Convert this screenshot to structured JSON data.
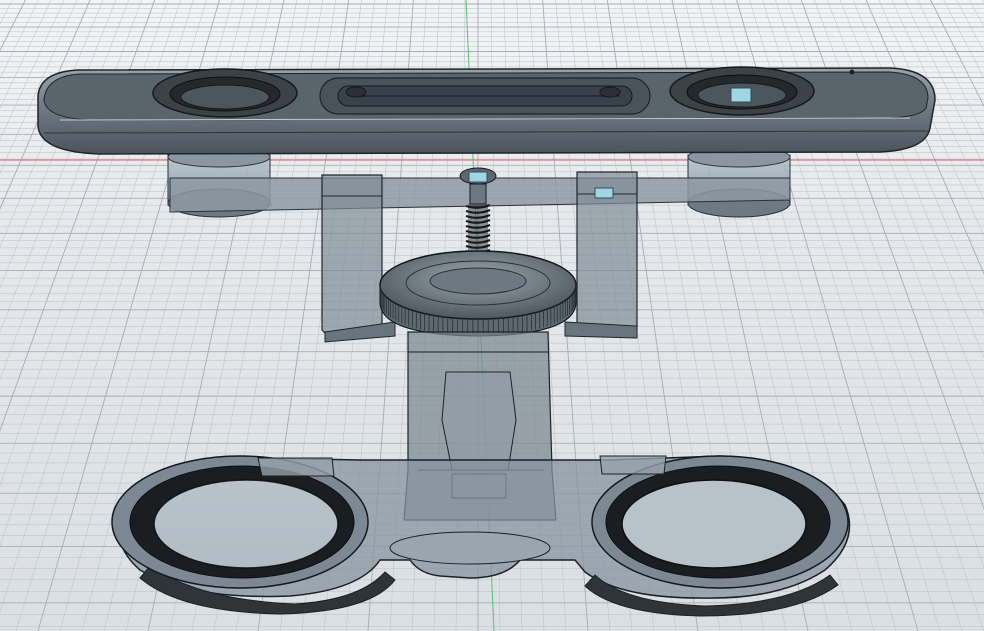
{
  "viewport": {
    "name": "3d-cad-viewport",
    "background_top": "#f2f4f6",
    "background_bottom": "#d9dee2",
    "grid_color": "#b9c0c6",
    "grid_major_color": "#a6aeb5",
    "axis_x_color": "#e35d5d",
    "axis_y_color": "#52c86a"
  },
  "model": {
    "body_color": "#7f8b94",
    "body_dark": "#3e464c",
    "edge_color": "#1f2428",
    "glass_color": "#9fb2bf",
    "gasket_color": "#1b1e21",
    "marker_color": "#9fd6e4",
    "parts": [
      {
        "id": "top-bar",
        "label": ""
      },
      {
        "id": "left-speaker",
        "label": ""
      },
      {
        "id": "right-speaker",
        "label": ""
      },
      {
        "id": "clamp-knob",
        "label": ""
      },
      {
        "id": "threaded-rod",
        "label": ""
      },
      {
        "id": "base-plate",
        "label": ""
      },
      {
        "id": "left-ring",
        "label": ""
      },
      {
        "id": "right-ring",
        "label": ""
      }
    ]
  }
}
